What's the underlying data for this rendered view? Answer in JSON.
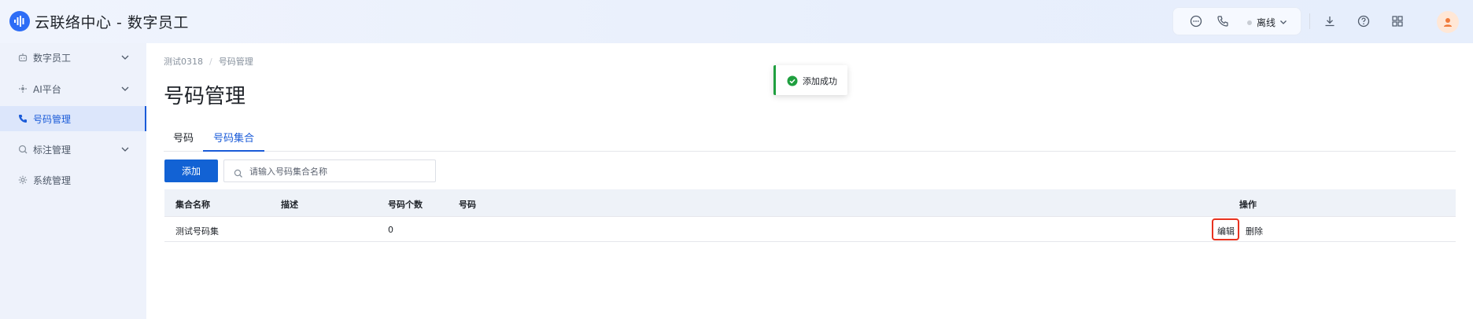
{
  "app": {
    "title": "云联络中心 - 数字员工",
    "logo_icon": "waveform-logo-icon"
  },
  "header": {
    "icons": [
      "chat-icon",
      "phone-icon",
      "download-icon",
      "help-icon",
      "apps-grid-icon"
    ],
    "status_label": "离线",
    "status_color": "#c9cdd4"
  },
  "sidebar": {
    "items": [
      {
        "label": "数字员工",
        "icon": "robot-icon",
        "expandable": true,
        "active": false
      },
      {
        "label": "AI平台",
        "icon": "ai-icon",
        "expandable": true,
        "active": false
      },
      {
        "label": "号码管理",
        "icon": "phone-icon",
        "expandable": false,
        "active": true
      },
      {
        "label": "标注管理",
        "icon": "tag-icon",
        "expandable": true,
        "active": false
      },
      {
        "label": "系统管理",
        "icon": "gear-icon",
        "expandable": false,
        "active": false
      }
    ]
  },
  "breadcrumb": {
    "items": [
      "测试0318",
      "号码管理"
    ],
    "separator": "/"
  },
  "page": {
    "title": "号码管理"
  },
  "tabs": [
    {
      "label": "号码",
      "active": false
    },
    {
      "label": "号码集合",
      "active": true
    }
  ],
  "toolbar": {
    "add_label": "添加",
    "search_placeholder": "请输入号码集合名称"
  },
  "table": {
    "headers": {
      "name": "集合名称",
      "description": "描述",
      "count": "号码个数",
      "numbers": "号码",
      "actions": "操作"
    },
    "rows": [
      {
        "name": "测试号码集",
        "description": "",
        "count": "0",
        "numbers": "",
        "edit_label": "编辑",
        "delete_label": "删除"
      }
    ]
  },
  "toast": {
    "message": "添加成功",
    "type": "success",
    "color": "#1f9f3f"
  },
  "colors": {
    "primary": "#1262d4",
    "link": "#1a5bd8",
    "highlight": "#e8321f"
  }
}
